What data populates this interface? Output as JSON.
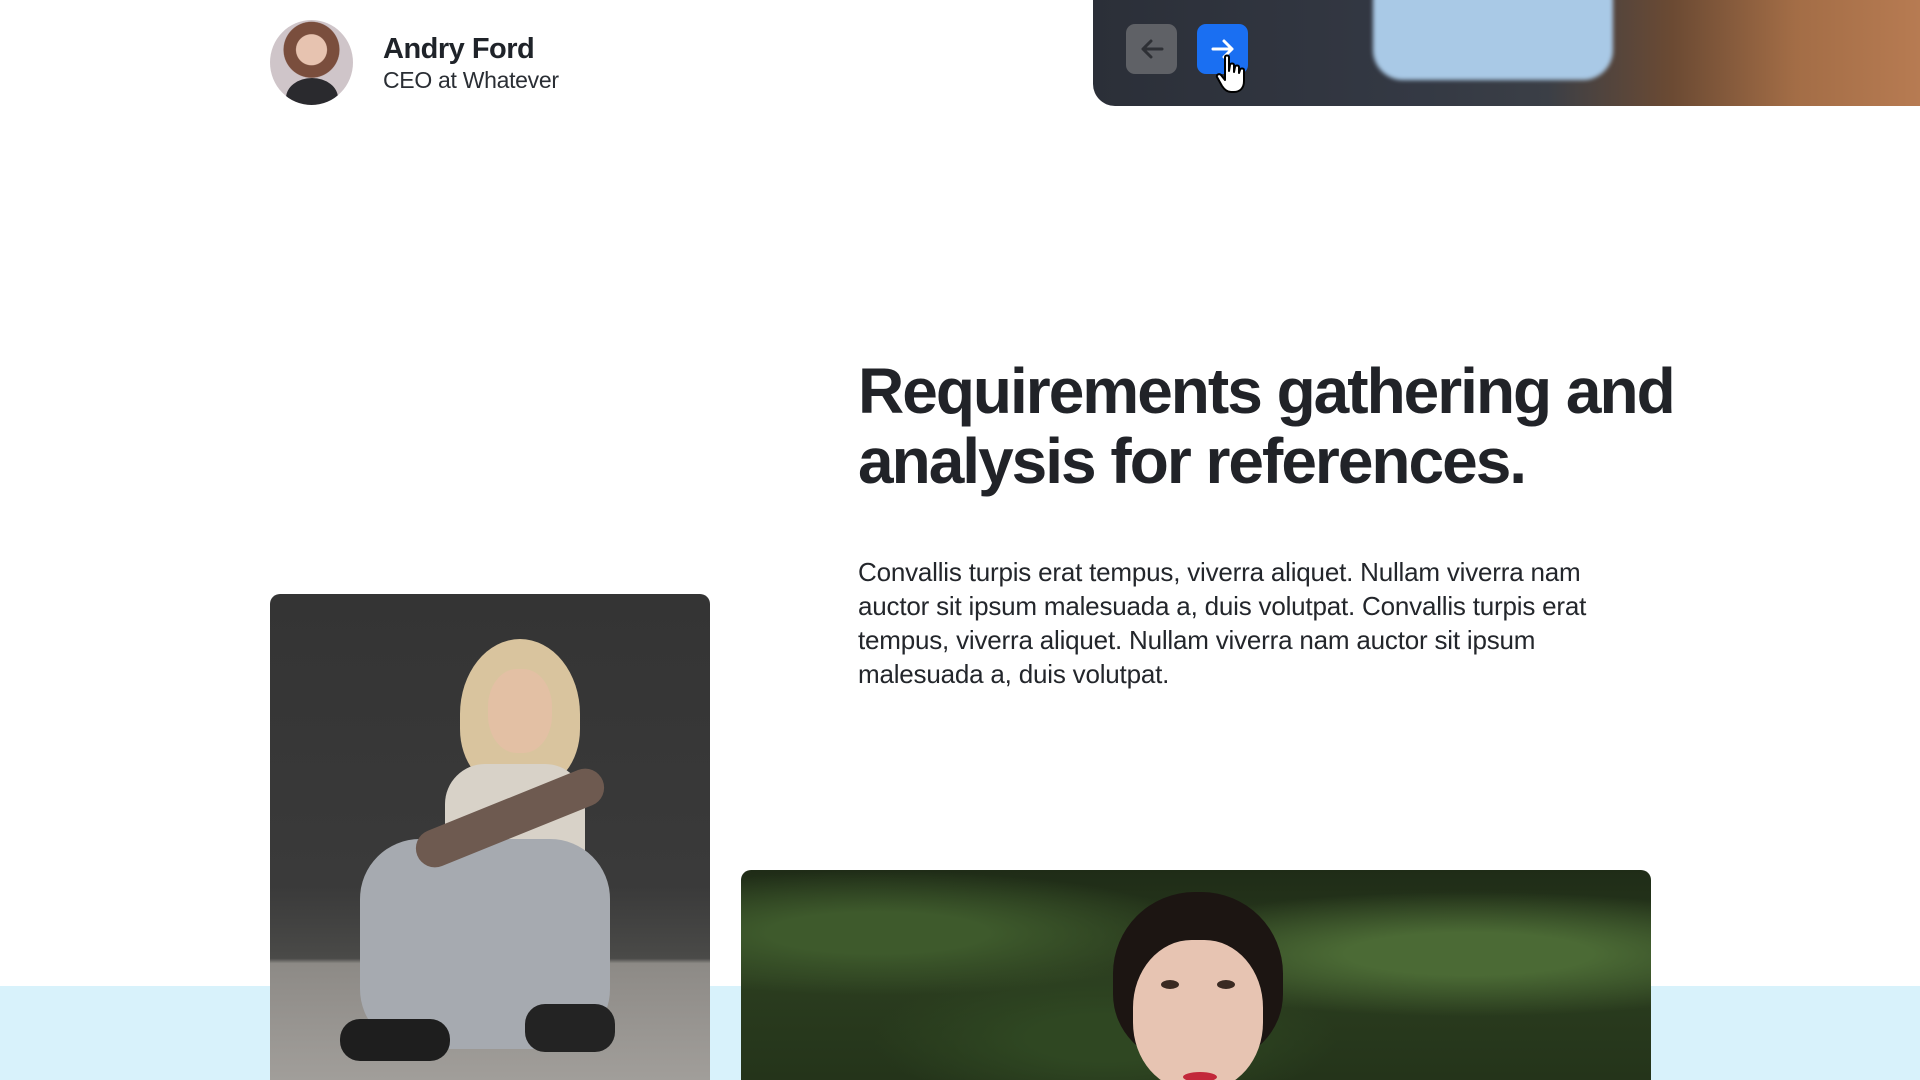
{
  "author": {
    "name": "Andry Ford",
    "role": "CEO at Whatever"
  },
  "carousel": {
    "prev_icon": "arrow-left-icon",
    "next_icon": "arrow-right-icon"
  },
  "section": {
    "headline": "Requirements gathering and analysis for references.",
    "body": "Convallis turpis erat tempus, viverra aliquet. Nullam viverra nam auctor sit ipsum malesuada a, duis volutpat. Convallis turpis erat tempus, viverra aliquet. Nullam viverra nam auctor sit ipsum malesuada a, duis volutpat."
  },
  "colors": {
    "accent": "#1a6ff2",
    "band": "#d8f2fb",
    "text": "#212328"
  }
}
